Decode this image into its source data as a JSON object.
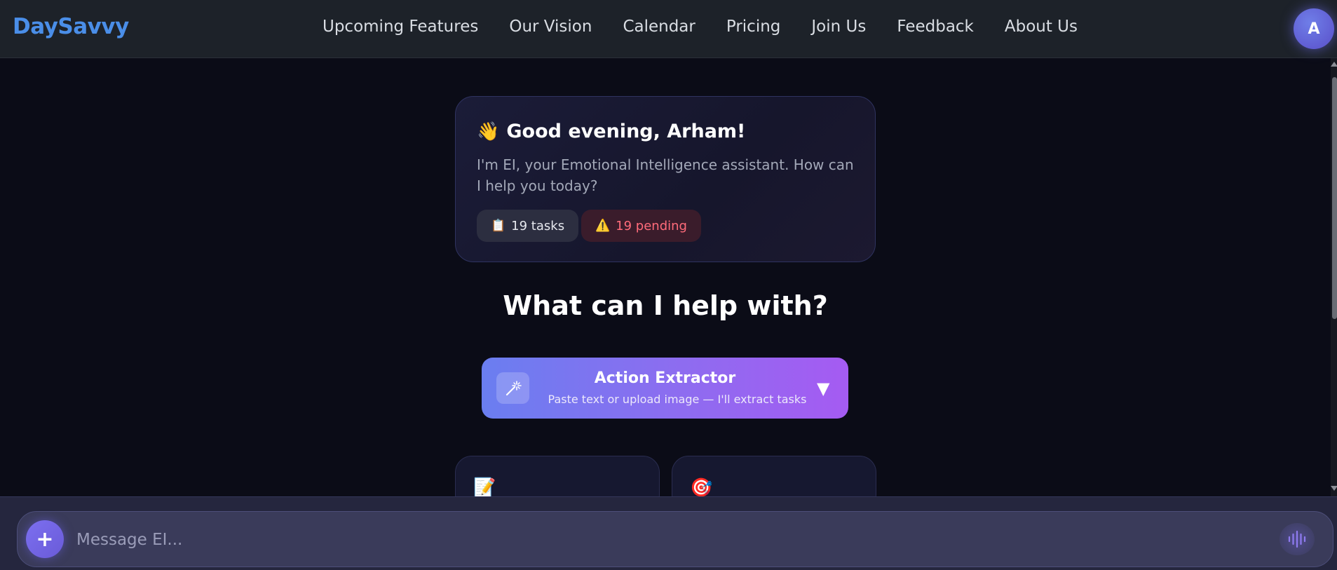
{
  "app": {
    "brand": "DaySavvy"
  },
  "nav": {
    "items": [
      {
        "label": "Upcoming Features"
      },
      {
        "label": "Our Vision"
      },
      {
        "label": "Calendar"
      },
      {
        "label": "Pricing"
      },
      {
        "label": "Join Us"
      },
      {
        "label": "Feedback"
      },
      {
        "label": "About Us"
      }
    ]
  },
  "user": {
    "avatar_initial": "A"
  },
  "greeting": {
    "icon": "waving-hand-icon",
    "emoji": "👋",
    "title": "Good evening, Arham!",
    "message": "I'm EI, your Emotional Intelligence assistant. How can I help you today?",
    "chips": {
      "tasks": {
        "icon": "clipboard-icon",
        "emoji": "📋",
        "label": "19 tasks"
      },
      "pending": {
        "icon": "warning-icon",
        "emoji": "⚠️",
        "label": "19 pending"
      }
    }
  },
  "help": {
    "title": "What can I help with?"
  },
  "action_extractor": {
    "icon": "magic-wand-icon",
    "title": "Action Extractor",
    "subtitle": "Paste text or upload image — I'll extract tasks",
    "caret": "▼"
  },
  "cards": [
    {
      "icon": "memo-icon",
      "emoji": "📝"
    },
    {
      "icon": "target-icon",
      "emoji": "🎯"
    }
  ],
  "composer": {
    "plus_symbol": "+",
    "placeholder": "Message EI..."
  },
  "colors": {
    "brand": "#4a8ee8",
    "background": "#0b0c17",
    "accent_gradient_start": "#6a7ef0",
    "accent_gradient_end": "#a55bf2",
    "pending": "#ff6b7a"
  }
}
